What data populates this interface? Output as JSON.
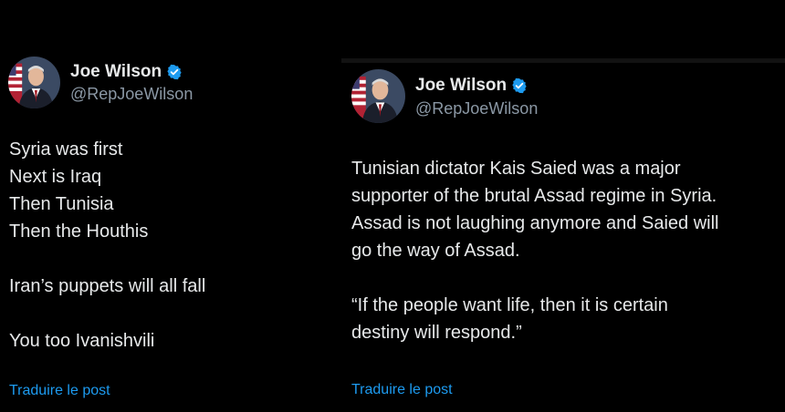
{
  "colors": {
    "background": "#000000",
    "text": "#e7e9ea",
    "muted": "#8b98a5",
    "link": "#1d9bf0",
    "verified": "#1d9bf0"
  },
  "posts": [
    {
      "author_name": "Joe Wilson",
      "handle": "@RepJoeWilson",
      "verified_icon": "verified-badge-icon",
      "lines": [
        "Syria was first",
        "Next is Iraq",
        "Then Tunisia",
        "Then the Houthis",
        "",
        "Iran’s puppets will all fall",
        "",
        "You too Ivanishvili"
      ],
      "translate_label": "Traduire le post"
    },
    {
      "author_name": "Joe Wilson",
      "handle": "@RepJoeWilson",
      "verified_icon": "verified-badge-icon",
      "lines": [
        "Tunisian dictator Kais Saied was a major",
        "supporter of the brutal Assad regime in Syria.",
        "Assad is not laughing anymore and Saied will",
        "go the way of Assad.",
        "",
        "“If the people want life, then it is certain",
        "destiny will respond.”"
      ],
      "translate_label": "Traduire le post"
    }
  ]
}
